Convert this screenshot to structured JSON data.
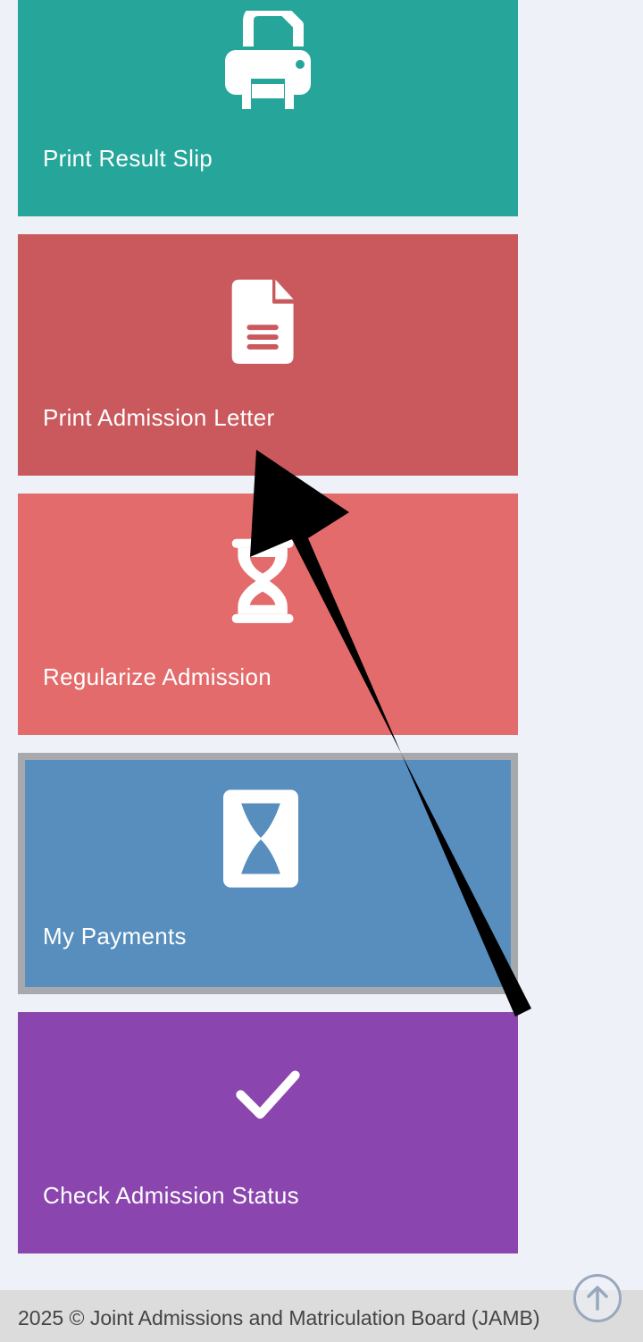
{
  "tiles": [
    {
      "label": "Print Result Slip",
      "icon": "printer-icon",
      "color": "#26a69a"
    },
    {
      "label": "Print Admission Letter",
      "icon": "document-icon",
      "color": "#c9595d"
    },
    {
      "label": "Regularize Admission",
      "icon": "hourglass-icon",
      "color": "#e36b6b"
    },
    {
      "label": "My Payments",
      "icon": "hourglass-box-icon",
      "color": "#588ebe",
      "selected": true
    },
    {
      "label": "Check Admission Status",
      "icon": "checkmark-icon",
      "color": "#8b45ae"
    }
  ],
  "footer": {
    "copyright": "2025 © Joint Admissions and Matriculation Board (JAMB)"
  },
  "scroll_top": {
    "icon": "arrow-up-icon"
  },
  "annotation": {
    "icon": "pointer-arrow-icon",
    "color": "#000000"
  }
}
